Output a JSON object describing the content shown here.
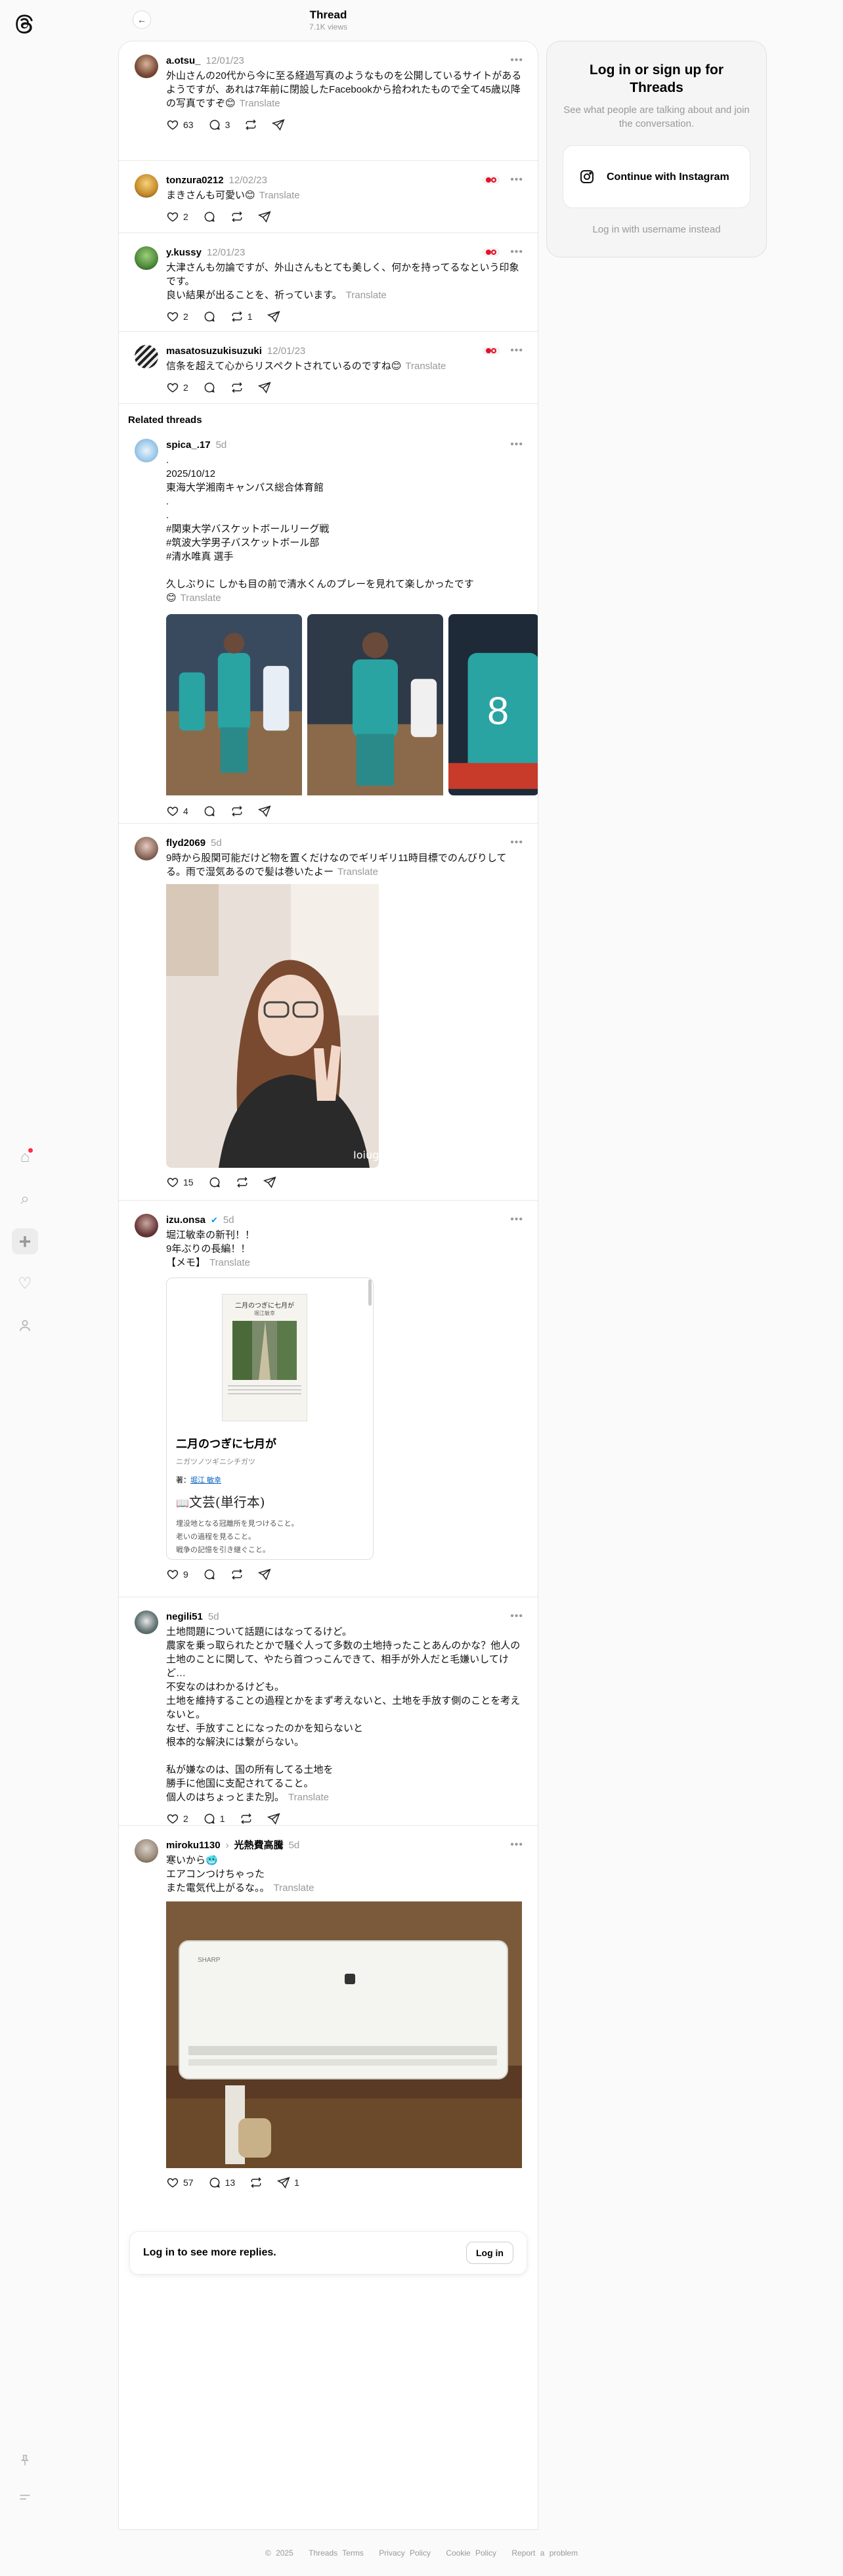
{
  "header": {
    "title": "Thread",
    "views": "7.1K views"
  },
  "side_panel": {
    "title": "Log in or sign up for Threads",
    "subtitle": "See what people are talking about and join the conversation.",
    "instagram_label": "Continue with Instagram",
    "username_link": "Log in with username instead"
  },
  "translate": "Translate",
  "related_label": "Related threads",
  "posts": [
    {
      "user": "a.otsu_",
      "date": "12/01/23",
      "text": "外山さんの20代から今に至る経過写真のようなものを公開しているサイトがあるようですが、あれは7年前に閉設したFacebookから拾われたもので全て45歳以降の写真ですぞ😊",
      "likes": "63",
      "replies": "3"
    },
    {
      "user": "tonzura0212",
      "date": "12/02/23",
      "text": "まきさんも可愛い😊",
      "likes": "2"
    },
    {
      "user": "y.kussy",
      "date": "12/01/23",
      "text": "大津さんも勿論ですが、外山さんもとても美しく、何かを持ってるなという印象です。\n良い結果が出ることを、祈っています。",
      "likes": "2",
      "reposts": "1"
    },
    {
      "user": "masatosuzukisuzuki",
      "date": "12/01/23",
      "text": "信条を超えて心からリスペクトされているのですね😊",
      "likes": "2"
    },
    {
      "user": "spica_.17",
      "date": "5d",
      "text": ".\n2025/10/12\n東海大学湘南キャンパス総合体育館\n.\n.\n#関東大学バスケットボールリーグ戦\n#筑波大学男子バスケットボール部\n#清水唯真 選手\n\n久しぶりに しかも目の前で清水くんのプレーを見れて楽しかったです\n😊",
      "likes": "4"
    },
    {
      "user": "flyd2069",
      "date": "5d",
      "text": "9時から股関可能だけど物を置くだけなのでギリギリ11時目標でのんびりしてる。雨で湿気あるので髪は巻いたよー",
      "likes": "15",
      "photo_tag": "Ioiug"
    },
    {
      "user": "izu.onsa",
      "date": "5d",
      "text": "堀江敏幸の新刊！！\n9年ぶりの長編！！\n【メモ】",
      "likes": "9",
      "card": {
        "cover_title": "二月のつぎに七月が",
        "cover_author": "堀江敏幸",
        "title": "二月のつぎに七月が",
        "kana": "ニガツノツギニシチガツ",
        "author_label": "著：",
        "author": "堀江 敏幸",
        "imprint": "文芸(単行本)",
        "lines": [
          "埋没地となる冠離所を見つけること。",
          "老いの過程を見ること。",
          "戦争の記憶を引き継ぐこと。"
        ]
      }
    },
    {
      "user": "negili51",
      "date": "5d",
      "text": "土地問題について話題にはなってるけど。\n農家を乗っ取られたとかで騒ぐ人って多数の土地持ったことあんのかな？他人の土地のことに関して、やたら首つっこんできて、相手が外人だと毛嫌いしてけど…\n不安なのはわかるけども。\n土地を維持することの過程とかをまず考えないと、土地を手放す側のことを考えないと。\nなぜ、手放すことになったのかを知らないと\n根本的な解決には繋がらない。\n\n私が嫌なのは、国の所有してる土地を\n勝手に他国に支配されてること。\n個人のはちょっとまた別。",
      "likes": "2",
      "replies": "1"
    },
    {
      "user": "miroku1130",
      "topic": "光熱費高騰",
      "date": "5d",
      "text": "寒いから🥶\nエアコンつけちゃった\nまた電気代上がるな。。",
      "likes": "57",
      "replies": "13",
      "shares": "1",
      "ac_brand": "SHARP"
    }
  ],
  "login_prompt": {
    "text": "Log in to see more replies.",
    "button": "Log in"
  },
  "footer": {
    "copyright": "© 2025",
    "links": [
      "Threads Terms",
      "Privacy Policy",
      "Cookie Policy",
      "Report a problem"
    ]
  }
}
